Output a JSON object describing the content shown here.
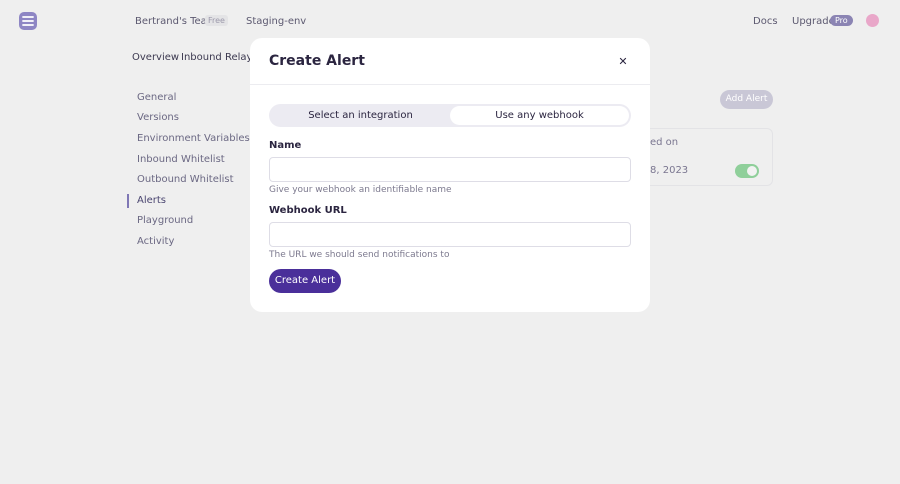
{
  "header": {
    "team_name": "Bertrand's Team",
    "team_plan": "Free",
    "environment": "Staging-env",
    "docs_label": "Docs",
    "upgrade_label": "Upgrade",
    "plan_badge": "Pro"
  },
  "subnav": {
    "items": [
      {
        "label": "Overview"
      },
      {
        "label": "Inbound Relay"
      }
    ]
  },
  "sidebar": {
    "items": [
      {
        "label": "General"
      },
      {
        "label": "Versions"
      },
      {
        "label": "Environment Variables"
      },
      {
        "label": "Inbound Whitelist"
      },
      {
        "label": "Outbound Whitelist"
      },
      {
        "label": "Alerts"
      },
      {
        "label": "Playground"
      },
      {
        "label": "Activity"
      }
    ],
    "active": "Alerts"
  },
  "background": {
    "add_alert_label": "Add Alert",
    "partial_text_1": "ed on",
    "partial_text_2": "8, 2023"
  },
  "modal": {
    "title": "Create Alert",
    "close_icon": "close-icon",
    "tabs": [
      {
        "label": "Select an integration",
        "selected": false
      },
      {
        "label": "Use any webhook",
        "selected": true
      }
    ],
    "name_field": {
      "label": "Name",
      "value": "",
      "placeholder": "",
      "help": "Give your webhook an identifiable name"
    },
    "url_field": {
      "label": "Webhook URL",
      "value": "",
      "placeholder": "",
      "help": "The URL we should send notifications to"
    },
    "submit_label": "Create Alert"
  },
  "colors": {
    "accent": "#4a2f9a",
    "logo": "#8e86c4",
    "toggle_on": "#8fcf9a"
  }
}
